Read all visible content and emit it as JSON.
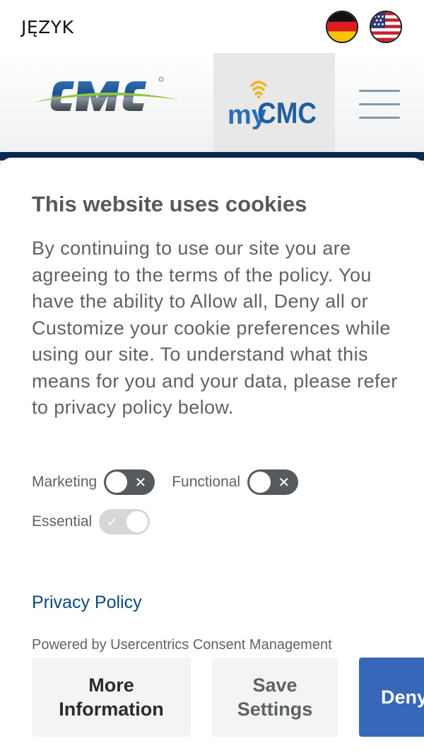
{
  "header": {
    "language_label": "JĘZYK",
    "flags": [
      {
        "icon": "germany-flag-icon"
      },
      {
        "icon": "usa-flag-icon"
      }
    ],
    "mycmc_logo": {
      "prefix": "my",
      "suffix": "CMC"
    },
    "colors": {
      "navy": "#0b2b53",
      "mycmc_blue": "#2a6fb3",
      "mycmc_yellow": "#f2b51c"
    }
  },
  "cookie_dialog": {
    "title": "This website uses cookies",
    "body": "By continuing to use our site you are agreeing to the terms of the policy. You have the ability to Allow all, Deny all or Customize your cookie preferences while using our site. To understand what this means for you and your data, please refer to privacy policy below.",
    "toggles": {
      "marketing": {
        "label": "Marketing",
        "enabled": false,
        "mark": "✕"
      },
      "functional": {
        "label": "Functional",
        "enabled": false,
        "mark": "✕"
      },
      "essential": {
        "label": "Essential",
        "enabled": true,
        "mark": "✓"
      }
    },
    "privacy_link": "Privacy Policy",
    "powered_by": "Powered by Usercentrics Consent Management",
    "buttons": {
      "more_info": [
        "More",
        "Information"
      ],
      "save_settings": [
        "Save",
        "Settings"
      ],
      "deny": "Deny"
    },
    "colors": {
      "deny_button": "#3667b8",
      "link": "#0c4a7a"
    }
  }
}
